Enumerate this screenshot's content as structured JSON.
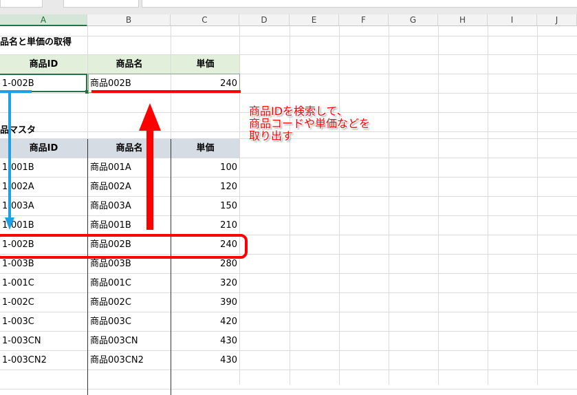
{
  "columns": [
    "A",
    "B",
    "C",
    "D",
    "E",
    "F",
    "G",
    "H",
    "I",
    "J"
  ],
  "section1": {
    "title": "品名と単価の取得",
    "headers": [
      "商品ID",
      "商品名",
      "単価"
    ],
    "row": {
      "id": "1-002B",
      "name": "商品002B",
      "price": "240"
    }
  },
  "section2": {
    "title": "品マスタ",
    "headers": [
      "商品ID",
      "商品名",
      "単価"
    ],
    "rows": [
      {
        "id": "1-001B",
        "name": "商品001A",
        "price": "100"
      },
      {
        "id": "1-002A",
        "name": "商品002A",
        "price": "120"
      },
      {
        "id": "1-003A",
        "name": "商品003A",
        "price": "150"
      },
      {
        "id": "1-001B",
        "name": "商品001B",
        "price": "210"
      },
      {
        "id": "1-002B",
        "name": "商品002B",
        "price": "240"
      },
      {
        "id": "1-003B",
        "name": "商品003B",
        "price": "280"
      },
      {
        "id": "1-001C",
        "name": "商品001C",
        "price": "320"
      },
      {
        "id": "1-002C",
        "name": "商品002C",
        "price": "390"
      },
      {
        "id": "1-003C",
        "name": "商品003C",
        "price": "420"
      },
      {
        "id": "1-003CN",
        "name": "商品003CN",
        "price": "430"
      },
      {
        "id": "1-003CN2",
        "name": "商品003CN2",
        "price": "430"
      }
    ]
  },
  "annotation": {
    "line1": "商品IDを検索して、",
    "line2": "商品コードや単価などを",
    "line3": "取り出す"
  },
  "colors": {
    "accent_red": "#ff0000",
    "accent_blue": "#1ea0e6",
    "excel_green": "#217346"
  }
}
